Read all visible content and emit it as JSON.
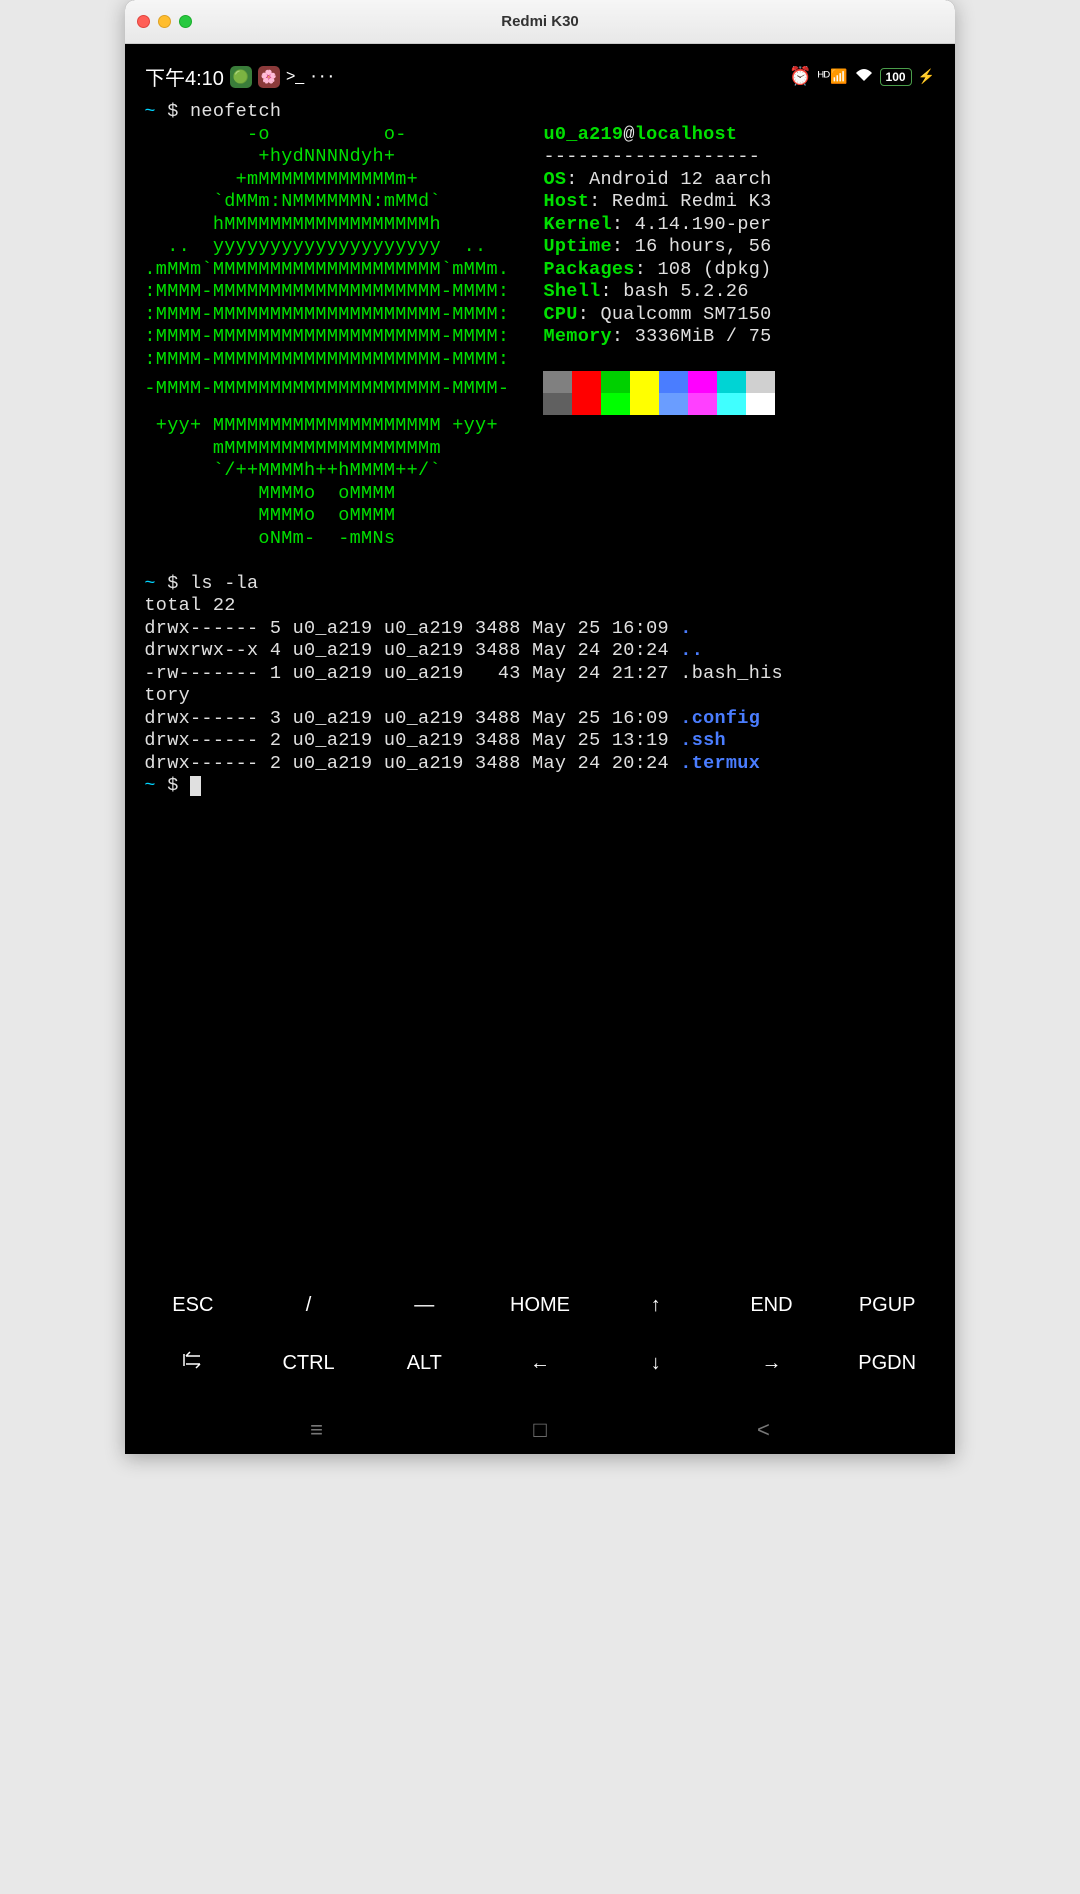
{
  "window": {
    "title": "Redmi K30"
  },
  "statusbar": {
    "time": "下午4:10",
    "battery": "100"
  },
  "terminal": {
    "prompt_tilde": "~",
    "prompt_dollar": "$",
    "cmd_neofetch": "neofetch",
    "cmd_ls": "ls -la",
    "logo": [
      "         -o          o-         ",
      "          +hydNNNNdyh+          ",
      "        +mMMMMMMMMMMMMm+        ",
      "      `dMMm:NMMMMMMN:mMMd`      ",
      "      hMMMMMMMMMMMMMMMMMMh      ",
      "  ..  yyyyyyyyyyyyyyyyyyyy  ..  ",
      ".mMMm`MMMMMMMMMMMMMMMMMMMM`mMMm.",
      ":MMMM-MMMMMMMMMMMMMMMMMMMM-MMMM:",
      ":MMMM-MMMMMMMMMMMMMMMMMMMM-MMMM:",
      ":MMMM-MMMMMMMMMMMMMMMMMMMM-MMMM:",
      ":MMMM-MMMMMMMMMMMMMMMMMMMM-MMMM:",
      "-MMMM-MMMMMMMMMMMMMMMMMMMM-MMMM-",
      " +yy+ MMMMMMMMMMMMMMMMMMMM +yy+ ",
      "      mMMMMMMMMMMMMMMMMMMm      ",
      "      `/++MMMMh++hMMMM++/`      ",
      "          MMMMo  oMMMM          ",
      "          MMMMo  oMMMM          ",
      "          oNMm-  -mMNs          "
    ],
    "nf": {
      "user": "u0_a219",
      "at": "@",
      "host": "localhost",
      "dash": "-------------------",
      "items": [
        {
          "key": "OS",
          "val": "Android 12 aarch"
        },
        {
          "key": "Host",
          "val": "Redmi Redmi K3"
        },
        {
          "key": "Kernel",
          "val": "4.14.190-per"
        },
        {
          "key": "Uptime",
          "val": "16 hours, 56"
        },
        {
          "key": "Packages",
          "val": "108 (dpkg)"
        },
        {
          "key": "Shell",
          "val": "bash 5.2.26"
        },
        {
          "key": "CPU",
          "val": "Qualcomm SM7150"
        },
        {
          "key": "Memory",
          "val": "3336MiB / 75"
        }
      ]
    },
    "ls": {
      "total": "total 22",
      "rows": [
        {
          "perm": "drwx------",
          "n": "5",
          "u": "u0_a219",
          "g": "u0_a219",
          "sz": "3488",
          "d": "May 25 16:09",
          "name": ".",
          "dir": true
        },
        {
          "perm": "drwxrwx--x",
          "n": "4",
          "u": "u0_a219",
          "g": "u0_a219",
          "sz": "3488",
          "d": "May 24 20:24",
          "name": "..",
          "dir": true
        },
        {
          "perm": "-rw-------",
          "n": "1",
          "u": "u0_a219",
          "g": "u0_a219",
          "sz": "  43",
          "d": "May 24 21:27",
          "name": ".bash_his",
          "dir": false,
          "wrap": "tory"
        },
        {
          "perm": "drwx------",
          "n": "3",
          "u": "u0_a219",
          "g": "u0_a219",
          "sz": "3488",
          "d": "May 25 16:09",
          "name": ".config",
          "dir": true
        },
        {
          "perm": "drwx------",
          "n": "2",
          "u": "u0_a219",
          "g": "u0_a219",
          "sz": "3488",
          "d": "May 25 13:19",
          "name": ".ssh",
          "dir": true
        },
        {
          "perm": "drwx------",
          "n": "2",
          "u": "u0_a219",
          "g": "u0_a219",
          "sz": "3488",
          "d": "May 24 20:24",
          "name": ".termux",
          "dir": true
        }
      ]
    }
  },
  "colors_top": [
    "#808080",
    "#ff0000",
    "#00d000",
    "#ffff00",
    "#4a7dff",
    "#ff00ff",
    "#00d4d4",
    "#d0d0d0"
  ],
  "colors_bot": [
    "#606060",
    "#ff0000",
    "#00ff00",
    "#ffff00",
    "#6a9dff",
    "#ff40ff",
    "#40ffff",
    "#ffffff"
  ],
  "keys_row1": [
    "ESC",
    "/",
    "—",
    "HOME",
    "↑",
    "END",
    "PGUP"
  ],
  "keys_row2": [
    "⇄",
    "CTRL",
    "ALT",
    "←",
    "↓",
    "→",
    "PGDN"
  ]
}
